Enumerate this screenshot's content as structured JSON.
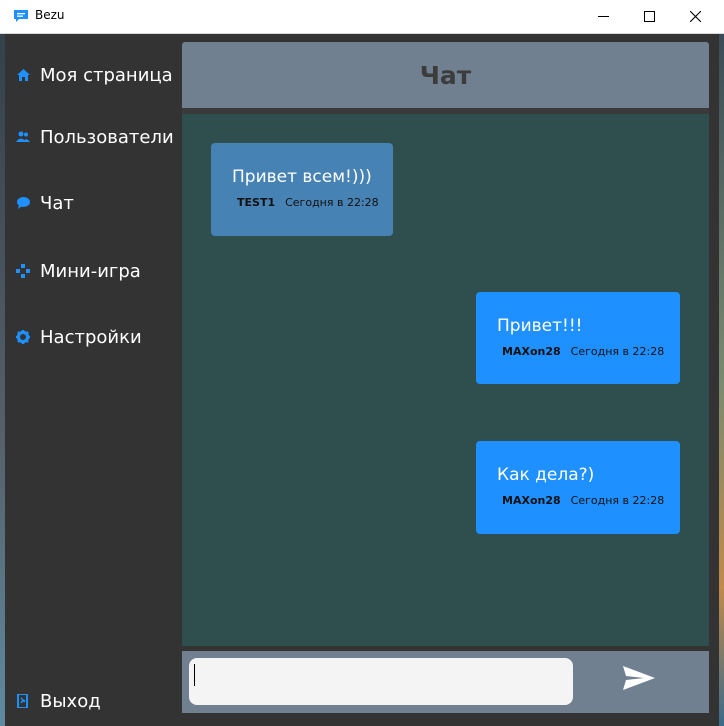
{
  "window": {
    "title": "Bezu",
    "controls": {
      "minimize": "minimize-icon",
      "maximize": "maximize-icon",
      "close": "close-icon"
    }
  },
  "sidebar": {
    "items": [
      {
        "label": "Моя страница",
        "icon": "home-icon"
      },
      {
        "label": "Пользователи",
        "icon": "users-icon"
      },
      {
        "label": "Чат",
        "icon": "chat-bubble-icon"
      },
      {
        "label": "Мини-игра",
        "icon": "gamepad-icon"
      },
      {
        "label": "Настройки",
        "icon": "gear-icon"
      }
    ],
    "exit": {
      "label": "Выход",
      "icon": "exit-icon"
    }
  },
  "header": {
    "title": "Чат"
  },
  "messages": [
    {
      "text": "Привет всем!)))",
      "author": "TEST1",
      "time": "Сегодня в 22:28",
      "align": "left"
    },
    {
      "text": "Привет!!!",
      "author": "MAXon28",
      "time": "Сегодня в 22:28",
      "align": "right"
    },
    {
      "text": "Как дела?)",
      "author": "MAXon28",
      "time": "Сегодня в 22:28",
      "align": "right"
    }
  ],
  "composer": {
    "value": "",
    "placeholder": "",
    "send_icon": "send-icon"
  },
  "colors": {
    "sidebar_bg": "#333333",
    "accent": "#1e90ff",
    "header_bg": "#708090",
    "chat_bg": "#2f4f4f",
    "incoming_bubble": "#4682b4",
    "outgoing_bubble": "#1e90ff"
  }
}
